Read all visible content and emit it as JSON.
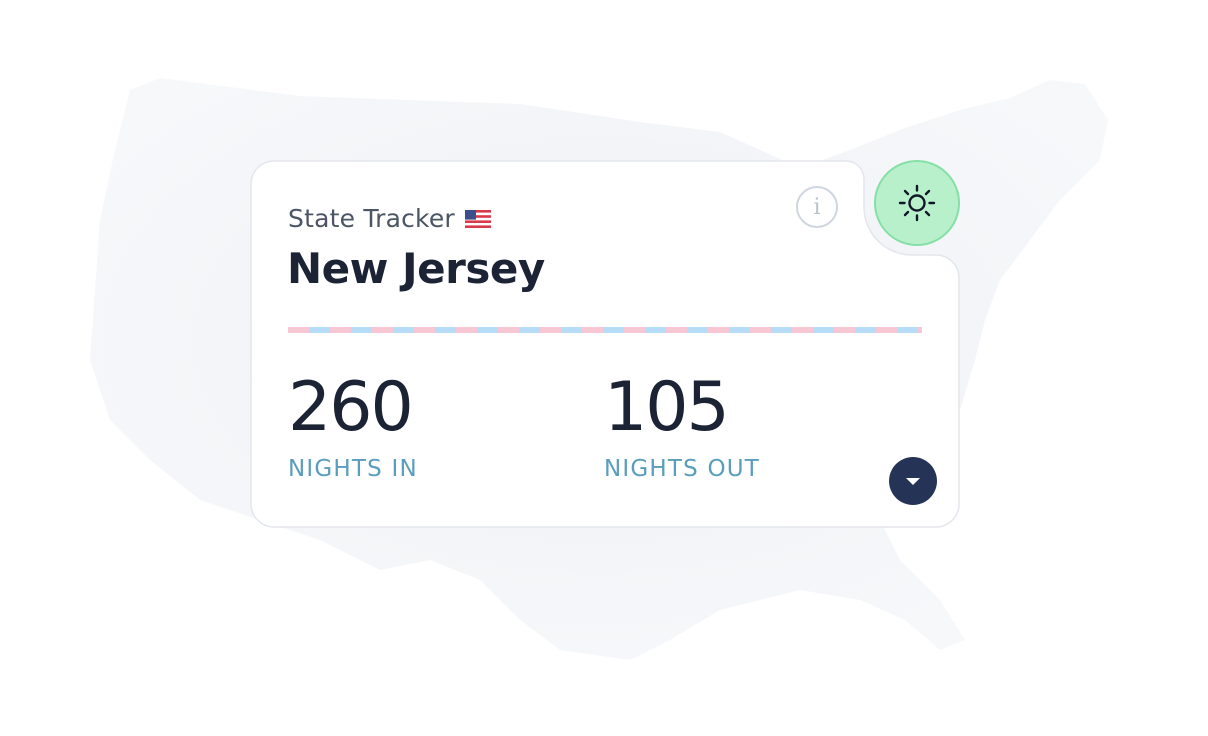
{
  "card": {
    "subtitle": "State Tracker",
    "flag_icon": "us-flag-icon",
    "title": "New Jersey",
    "info_icon": "info-icon",
    "info_glyph": "i",
    "stats": [
      {
        "value": "260",
        "label": "NIGHTS IN"
      },
      {
        "value": "105",
        "label": "NIGHTS OUT"
      }
    ],
    "expand_icon": "caret-down-icon"
  },
  "theme_toggle": {
    "icon": "sun-icon"
  },
  "colors": {
    "title": "#1b2334",
    "label": "#5a9dbd",
    "expand_button": "#253356",
    "theme_button": "#b9f0cc",
    "divider_pink": "#f7c7d3",
    "divider_blue": "#b7dcf7"
  }
}
